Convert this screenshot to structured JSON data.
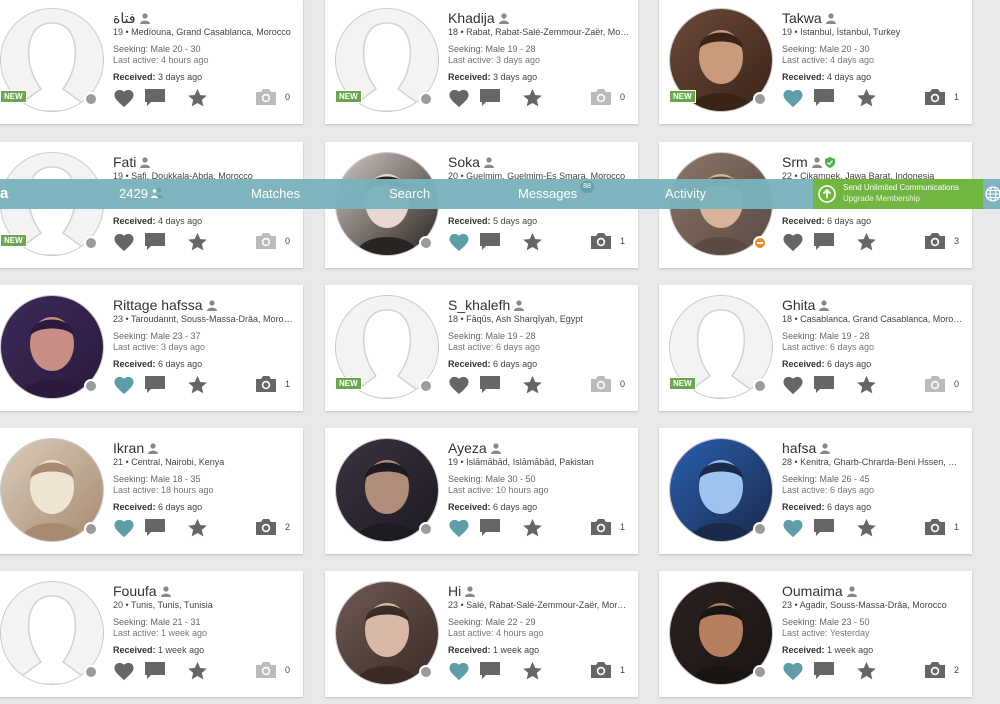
{
  "nav": {
    "logo": "a",
    "count": "2429",
    "matches": "Matches",
    "search": "Search",
    "messages": "Messages",
    "messages_badge": "88",
    "activity": "Activity",
    "upgrade_line1": "Send Unlimited Communications",
    "upgrade_line2": "Upgrade Membership",
    "icons": [
      "people-icon",
      "upload-arrow-icon",
      "globe-icon"
    ]
  },
  "colors": {
    "navbar": "#7bb3bd",
    "upgrade": "#6db43b",
    "heart_active": "#5e9ea8",
    "icon_gray": "#666666",
    "new_badge": "#6aa84f"
  },
  "new_label": "NEW",
  "profiles": [
    {
      "name": "فتاة",
      "location": "19 • Medïouna, Grand Casablanca, Morocco",
      "seeking": "Seeking: Male 20 - 30",
      "last_active": "Last active: 4 hours ago",
      "received_label": "Received:",
      "received": "3 days ago",
      "photos": "0",
      "new": true,
      "liked": false,
      "photo_type": "placeholder",
      "status": "offline"
    },
    {
      "name": "Khadija",
      "location": "18 • Rabat, Rabat-Salé-Zemmour-Zaër, Mor...",
      "seeking": "Seeking: Male 19 - 28",
      "last_active": "Last active: 3 days ago",
      "received_label": "Received:",
      "received": "3 days ago",
      "photos": "0",
      "new": true,
      "liked": false,
      "photo_type": "placeholder",
      "status": "offline"
    },
    {
      "name": "Takwa",
      "location": "19 • Istanbul, İstanbul, Turkey",
      "seeking": "Seeking: Male 20 - 30",
      "last_active": "Last active: 4 days ago",
      "received_label": "Received:",
      "received": "4 days ago",
      "photos": "1",
      "new": true,
      "liked": true,
      "photo_type": "photo",
      "status": "offline"
    },
    {
      "name": "Fati",
      "location": "19 • Safi, Doukkala-Abda, Morocco",
      "seeking": "",
      "last_active": "",
      "received_label": "Received:",
      "received": "4 days ago",
      "photos": "0",
      "new": true,
      "liked": false,
      "photo_type": "placeholder",
      "status": "offline"
    },
    {
      "name": "Soka",
      "location": "20 • Guelmim, Guelmim-Es Smara, Morocco",
      "seeking": "",
      "last_active": "",
      "received_label": "Received:",
      "received": "5 days ago",
      "photos": "1",
      "new": false,
      "liked": true,
      "photo_type": "photo",
      "status": "offline"
    },
    {
      "name": "Srm",
      "location": "22 • Cikampek, Jawa Barat, Indonesia",
      "seeking": "",
      "last_active": "",
      "received_label": "Received:",
      "received": "6 days ago",
      "photos": "3",
      "new": false,
      "liked": false,
      "photo_type": "photo",
      "status": "away",
      "verified": true
    },
    {
      "name": "Rittage hafssa",
      "location": "23 • Taroudannt, Souss-Massa-Drâa, Moroc...",
      "seeking": "Seeking: Male 23 - 37",
      "last_active": "Last active: 3 days ago",
      "received_label": "Received:",
      "received": "6 days ago",
      "photos": "1",
      "new": false,
      "liked": true,
      "photo_type": "photo",
      "status": "offline"
    },
    {
      "name": "S_khalefh",
      "location": "18 • Fāqūs, Ash Sharqīyah, Egypt",
      "seeking": "Seeking: Male 19 - 28",
      "last_active": "Last active: 6 days ago",
      "received_label": "Received:",
      "received": "6 days ago",
      "photos": "0",
      "new": true,
      "liked": false,
      "photo_type": "placeholder",
      "status": "offline"
    },
    {
      "name": "Ghita",
      "location": "18 • Casablanca, Grand Casablanca, Moroc...",
      "seeking": "Seeking: Male 19 - 28",
      "last_active": "Last active: 6 days ago",
      "received_label": "Received:",
      "received": "6 days ago",
      "photos": "0",
      "new": true,
      "liked": false,
      "photo_type": "placeholder",
      "status": "offline"
    },
    {
      "name": "Ikran",
      "location": "21 • Central, Nairobi, Kenya",
      "seeking": "Seeking: Male 18 - 35",
      "last_active": "Last active: 18 hours ago",
      "received_label": "Received:",
      "received": "6 days ago",
      "photos": "2",
      "new": false,
      "liked": true,
      "photo_type": "photo",
      "status": "offline"
    },
    {
      "name": "Ayeza",
      "location": "19 • Islāmābād, Islāmābād, Pakistan",
      "seeking": "Seeking: Male 30 - 50",
      "last_active": "Last active: 10 hours ago",
      "received_label": "Received:",
      "received": "6 days ago",
      "photos": "1",
      "new": false,
      "liked": true,
      "photo_type": "photo",
      "status": "offline"
    },
    {
      "name": "hafsa",
      "location": "28 • Kenitra, Gharb-Chrarda-Beni Hssen, Mo...",
      "seeking": "Seeking: Male 26 - 45",
      "last_active": "Last active: 6 days ago",
      "received_label": "Received:",
      "received": "6 days ago",
      "photos": "1",
      "new": false,
      "liked": true,
      "photo_type": "photo",
      "status": "offline"
    },
    {
      "name": "Fouufa",
      "location": "20 • Tunis, Tunis, Tunisia",
      "seeking": "Seeking: Male 21 - 31",
      "last_active": "Last active: 1 week ago",
      "received_label": "Received:",
      "received": "1 week ago",
      "photos": "0",
      "new": false,
      "liked": false,
      "photo_type": "placeholder",
      "status": "offline"
    },
    {
      "name": "Hi",
      "location": "23 • Salé, Rabat-Salé-Zemmour-Zaër, Moroc...",
      "seeking": "Seeking: Male 22 - 29",
      "last_active": "Last active: 4 hours ago",
      "received_label": "Received:",
      "received": "1 week ago",
      "photos": "1",
      "new": false,
      "liked": true,
      "photo_type": "photo",
      "status": "offline"
    },
    {
      "name": "Oumaima",
      "location": "23 • Agadir, Souss-Massa-Drâa, Morocco",
      "seeking": "Seeking: Male 23 - 50",
      "last_active": "Last active: Yesterday",
      "received_label": "Received:",
      "received": "1 week ago",
      "photos": "2",
      "new": false,
      "liked": true,
      "photo_type": "photo",
      "status": "offline"
    }
  ]
}
